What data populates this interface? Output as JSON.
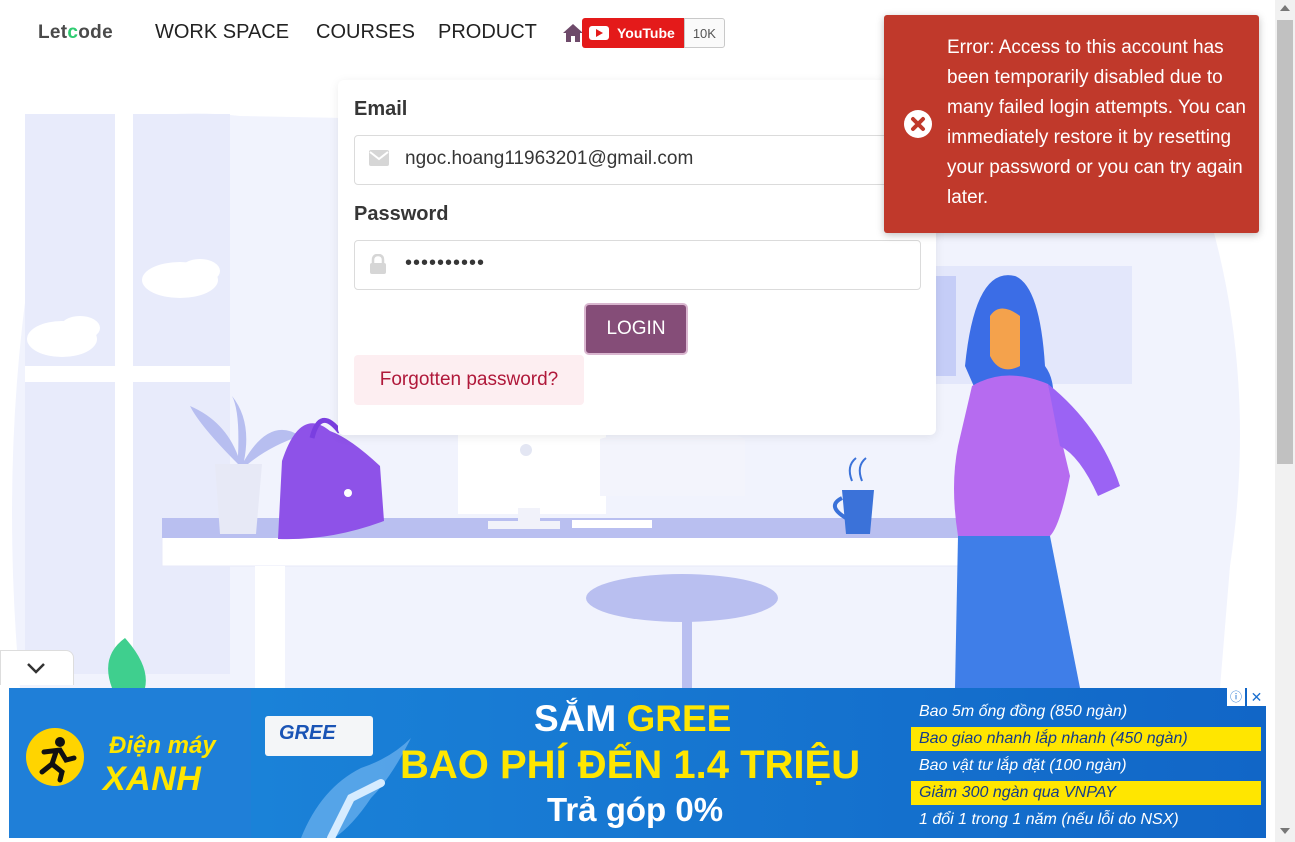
{
  "nav": {
    "logo_pre": "Let",
    "logo_acc": "c",
    "logo_post": "ode",
    "items": [
      "WORK SPACE",
      "COURSES",
      "PRODUCT"
    ],
    "youtube_label": "YouTube",
    "youtube_count": "10K"
  },
  "login": {
    "email_label": "Email",
    "email_value": "ngoc.hoang11963201@gmail.com",
    "password_label": "Password",
    "password_value": "••••••••••",
    "login_button": "LOGIN",
    "forgot_link": "Forgotten password?"
  },
  "toast": {
    "message": "Error: Access to this account has been temporarily disabled due to many failed login attempts. You can immediately restore it by resetting your password or you can try again later."
  },
  "ad": {
    "brand_line1": "Điện máy",
    "brand_line2": "XANH",
    "product_brand": "GREE",
    "headline_white": "SẮM ",
    "headline_yellow": "GREE",
    "subheadline": "BAO PHÍ ĐẾN 1.4 TRIỆU",
    "installment": "Trả góp 0%",
    "benefits": [
      "Bao 5m ống đồng (850 ngàn)",
      "Bao giao nhanh lắp nhanh (450 ngàn)",
      "Bao vật tư lắp đặt (100 ngàn)",
      "Giảm 300 ngàn qua VNPAY",
      "1 đổi 1 trong 1 năm (nếu lỗi do NSX)"
    ],
    "info": "ⓘ",
    "close": "✕"
  },
  "colors": {
    "login_button": "#854d78",
    "toast_bg": "#c0392b",
    "forgot_bg": "#fdeef1",
    "forgot_text": "#b0183a",
    "ad_bg": "#1576d1",
    "ad_yellow": "#ffe600"
  }
}
